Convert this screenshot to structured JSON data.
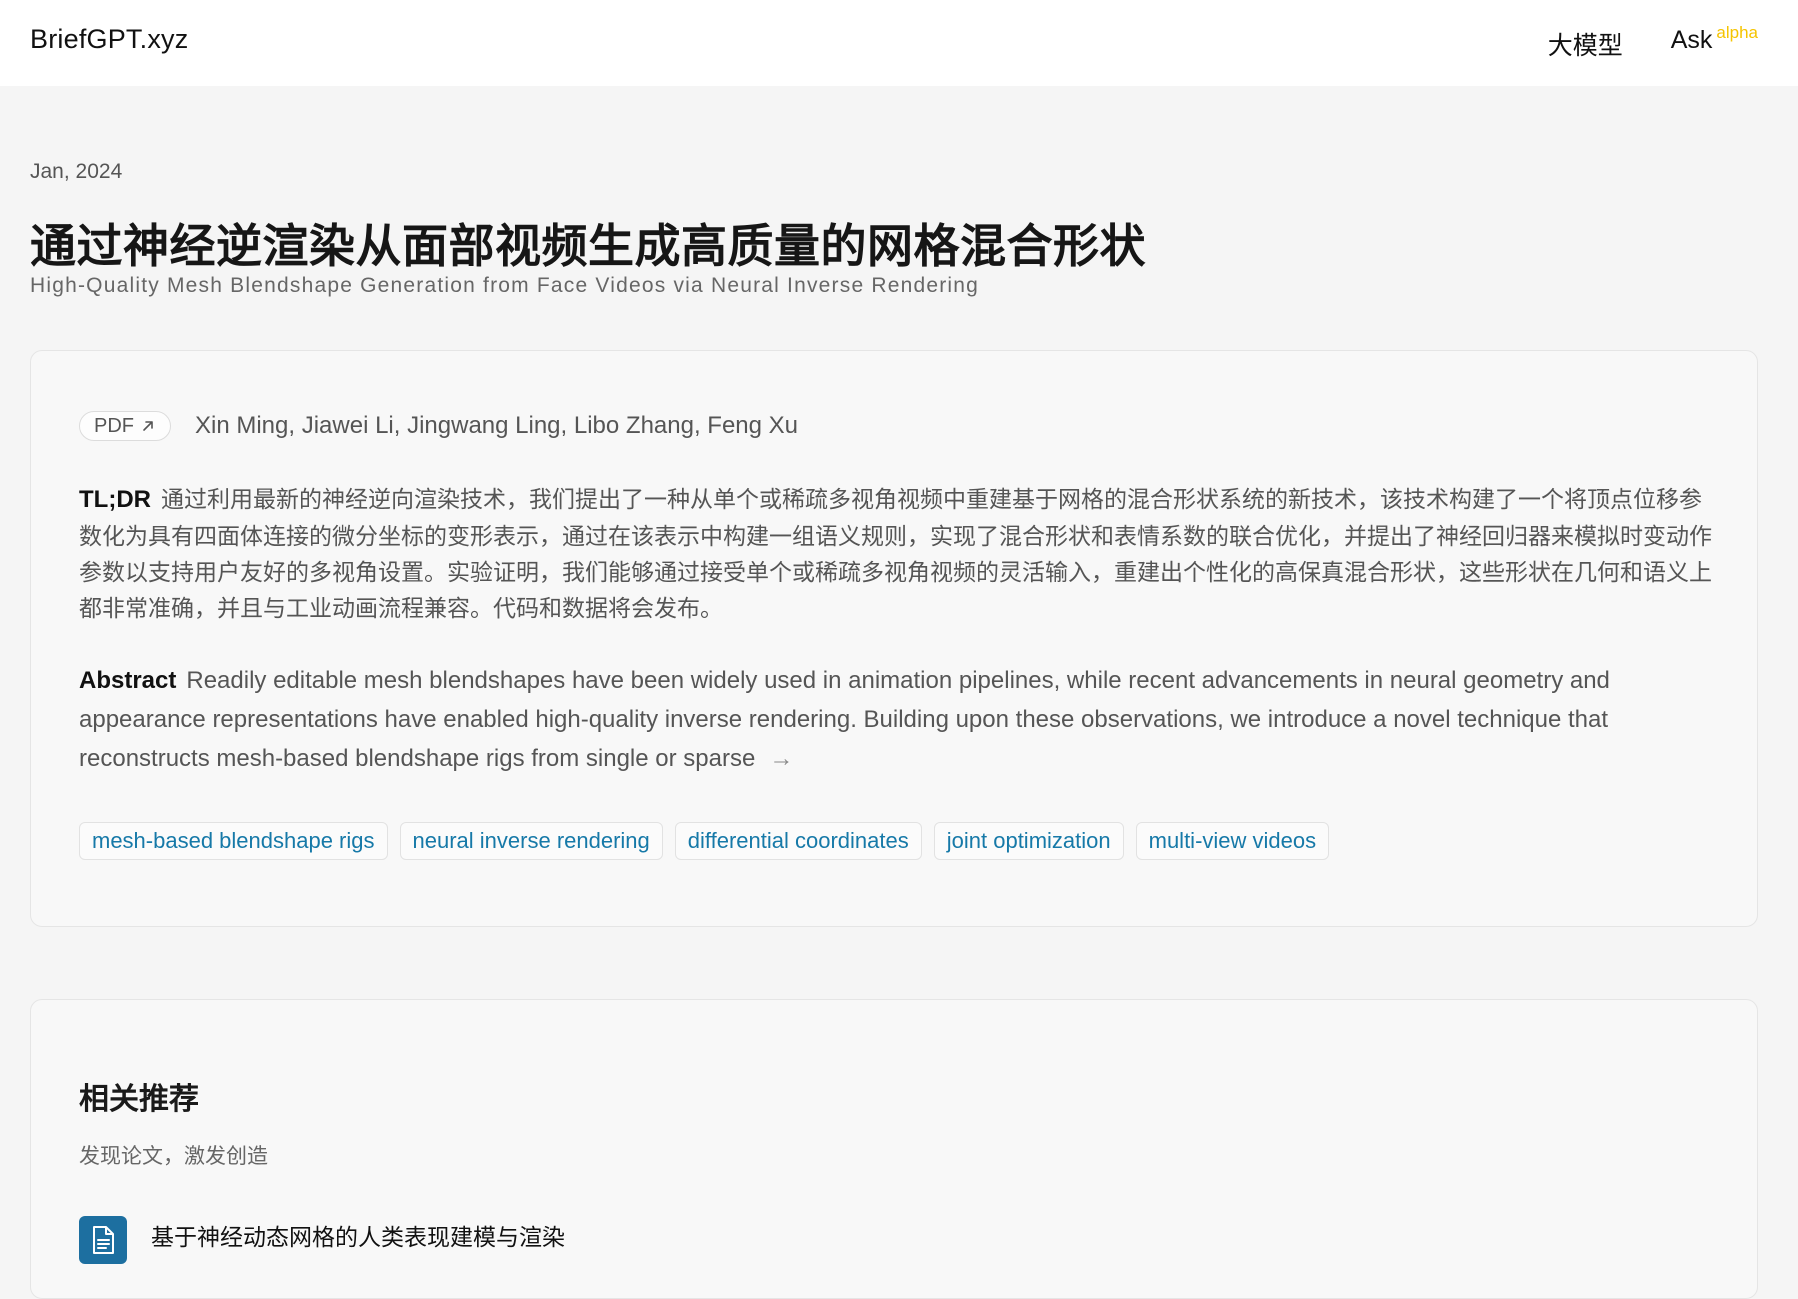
{
  "header": {
    "brand": "BriefGPT.xyz",
    "nav": {
      "models": "大模型",
      "ask": "Ask",
      "ask_badge": "alpha"
    }
  },
  "paper": {
    "date": "Jan, 2024",
    "title_zh": "通过神经逆渲染从面部视频生成高质量的网格混合形状",
    "title_en": "High-Quality Mesh Blendshape Generation from Face Videos via Neural Inverse Rendering",
    "pdf_label": "PDF",
    "authors": "Xin Ming, Jiawei Li, Jingwang Ling, Libo Zhang, Feng Xu",
    "tldr_label": "TL;DR",
    "tldr": "通过利用最新的神经逆向渲染技术，我们提出了一种从单个或稀疏多视角视频中重建基于网格的混合形状系统的新技术，该技术构建了一个将顶点位移参数化为具有四面体连接的微分坐标的变形表示，通过在该表示中构建一组语义规则，实现了混合形状和表情系数的联合优化，并提出了神经回归器来模拟时变动作参数以支持用户友好的多视角设置。实验证明，我们能够通过接受单个或稀疏多视角视频的灵活输入，重建出个性化的高保真混合形状，这些形状在几何和语义上都非常准确，并且与工业动画流程兼容。代码和数据将会发布。",
    "abstract_label": "Abstract",
    "abstract": "Readily editable mesh blendshapes have been widely used in animation pipelines, while recent advancements in neural geometry and appearance representations have enabled high-quality inverse rendering. Building upon these observations, we introduce a novel technique that reconstructs mesh-based blendshape rigs from single or sparse",
    "more_arrow": "→",
    "tags": [
      "mesh-based blendshape rigs",
      "neural inverse rendering",
      "differential coordinates",
      "joint optimization",
      "multi-view videos"
    ]
  },
  "recommendations": {
    "title": "相关推荐",
    "subtitle": "发现论文，激发创造",
    "items": [
      {
        "title": "基于神经动态网格的人类表现建模与渲染",
        "icon": "document-icon"
      }
    ]
  },
  "colors": {
    "accent_tag": "#1679a8",
    "alpha_badge": "#f5c400",
    "doc_icon_bg": "#1d6fa0"
  }
}
